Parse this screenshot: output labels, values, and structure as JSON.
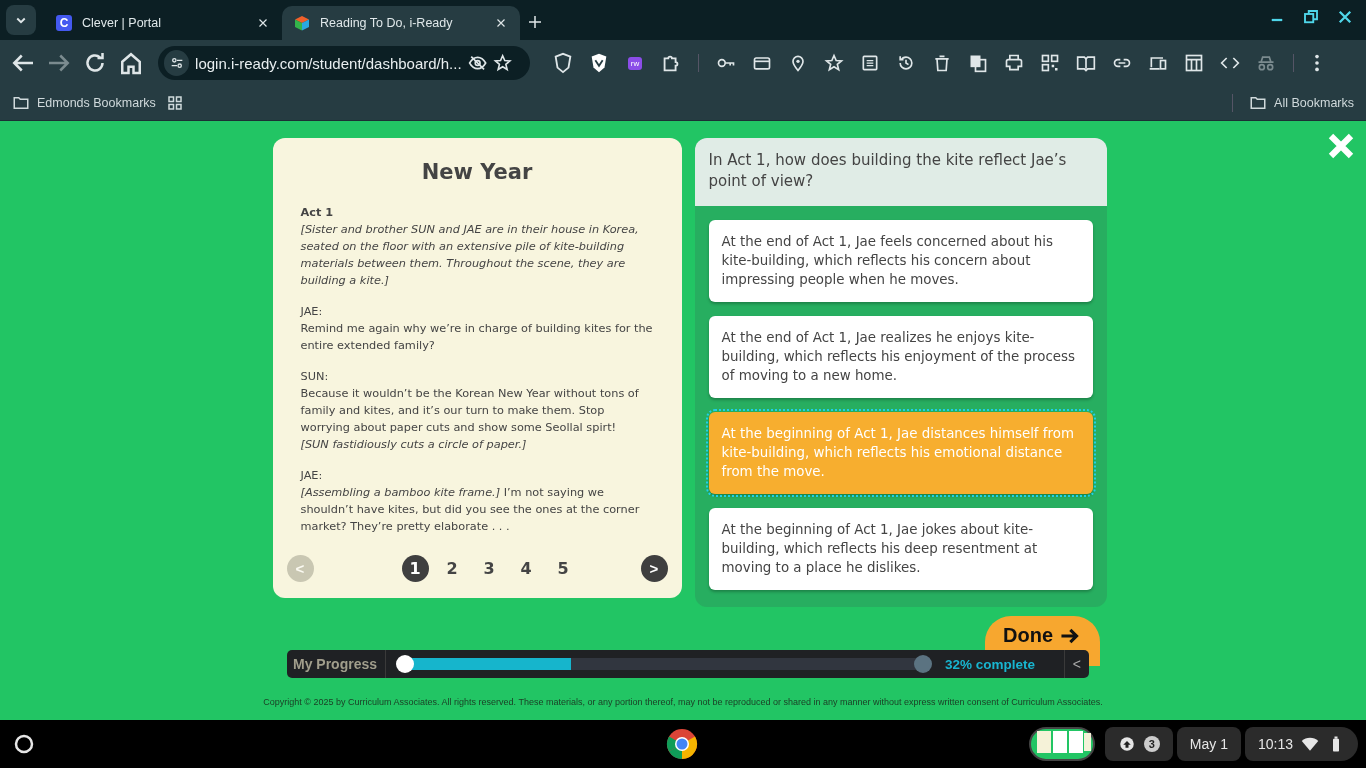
{
  "browser": {
    "tabs": [
      {
        "title": "Clever | Portal",
        "selected": false,
        "kind": "letter",
        "favicon_text": "C"
      },
      {
        "title": "Reading To Do, i-Ready",
        "selected": true,
        "kind": "cube"
      }
    ],
    "url": "login.i-ready.com/student/dashboard/h...",
    "extension_badge": "rw",
    "bookmarks": {
      "left": "Edmonds Bookmarks",
      "right": "All Bookmarks"
    }
  },
  "passage": {
    "title": "New Year",
    "paragraphs": [
      [
        {
          "kind": "heading",
          "text": "Act 1"
        },
        {
          "kind": "direction",
          "text": "[Sister and brother SUN and JAE are in their house in Korea, seated on the floor with an extensive pile of kite-building materials between them. Throughout the scene, they are building a kite.]"
        }
      ],
      [
        {
          "kind": "speaker",
          "text": "JAE:"
        },
        {
          "kind": "line",
          "text": "Remind me again why we’re in charge of building kites for the entire extended family?"
        }
      ],
      [
        {
          "kind": "speaker",
          "text": "SUN:"
        },
        {
          "kind": "line",
          "text": "Because it wouldn’t be the Korean New Year without tons of family and kites, and it’s our turn to make them. Stop worrying about paper cuts and show some Seollal spirt!"
        },
        {
          "kind": "direction",
          "text": "[SUN fastidiously cuts a circle of paper.]"
        }
      ],
      [
        {
          "kind": "speaker",
          "text": "JAE:"
        },
        {
          "kind": "line",
          "text": "*[Assembling a bamboo kite frame.]* I’m not saying we shouldn’t have kites, but did you see the ones at the corner market? They’re pretty elaborate . . ."
        }
      ]
    ],
    "prev": {
      "label": "<",
      "disabled": true
    },
    "pages": [
      {
        "label": "1",
        "selected": true
      },
      {
        "label": "2",
        "selected": false
      },
      {
        "label": "3",
        "selected": false
      },
      {
        "label": "4",
        "selected": false
      },
      {
        "label": "5",
        "selected": false
      }
    ],
    "next": {
      "label": ">",
      "disabled": false
    }
  },
  "question": {
    "prompt": "In Act 1, how does building the kite reflect Jae’s point of view?",
    "answers": [
      {
        "text": "At the end of Act 1, Jae feels concerned about his kite-building, which reflects his concern about impressing people when he moves.",
        "selected": false
      },
      {
        "text": "At the end of Act 1, Jae realizes he enjoys kite-building, which reflects his enjoyment of the process of moving to a new home.",
        "selected": false
      },
      {
        "text": "At the beginning of Act 1, Jae distances himself from kite-building, which reflects his emotional distance from the move.",
        "selected": true
      },
      {
        "text": "At the beginning of Act 1, Jae jokes about kite-building, which reflects his deep resentment at moving to a place he dislikes.",
        "selected": false
      }
    ]
  },
  "done_button": "Done",
  "progress": {
    "label": "My Progress",
    "level": 0.32,
    "reading": "32% complete",
    "toggle": "<"
  },
  "copyright": "Copyright © 2025 by Curriculum Associates. All rights reserved. These materials, or any portion thereof, may not be reproduced or shared in any manner without express written consent of Curriculum Associates.",
  "shelf": {
    "notification_count": "3",
    "date": "May 1",
    "time": "10:13"
  }
}
